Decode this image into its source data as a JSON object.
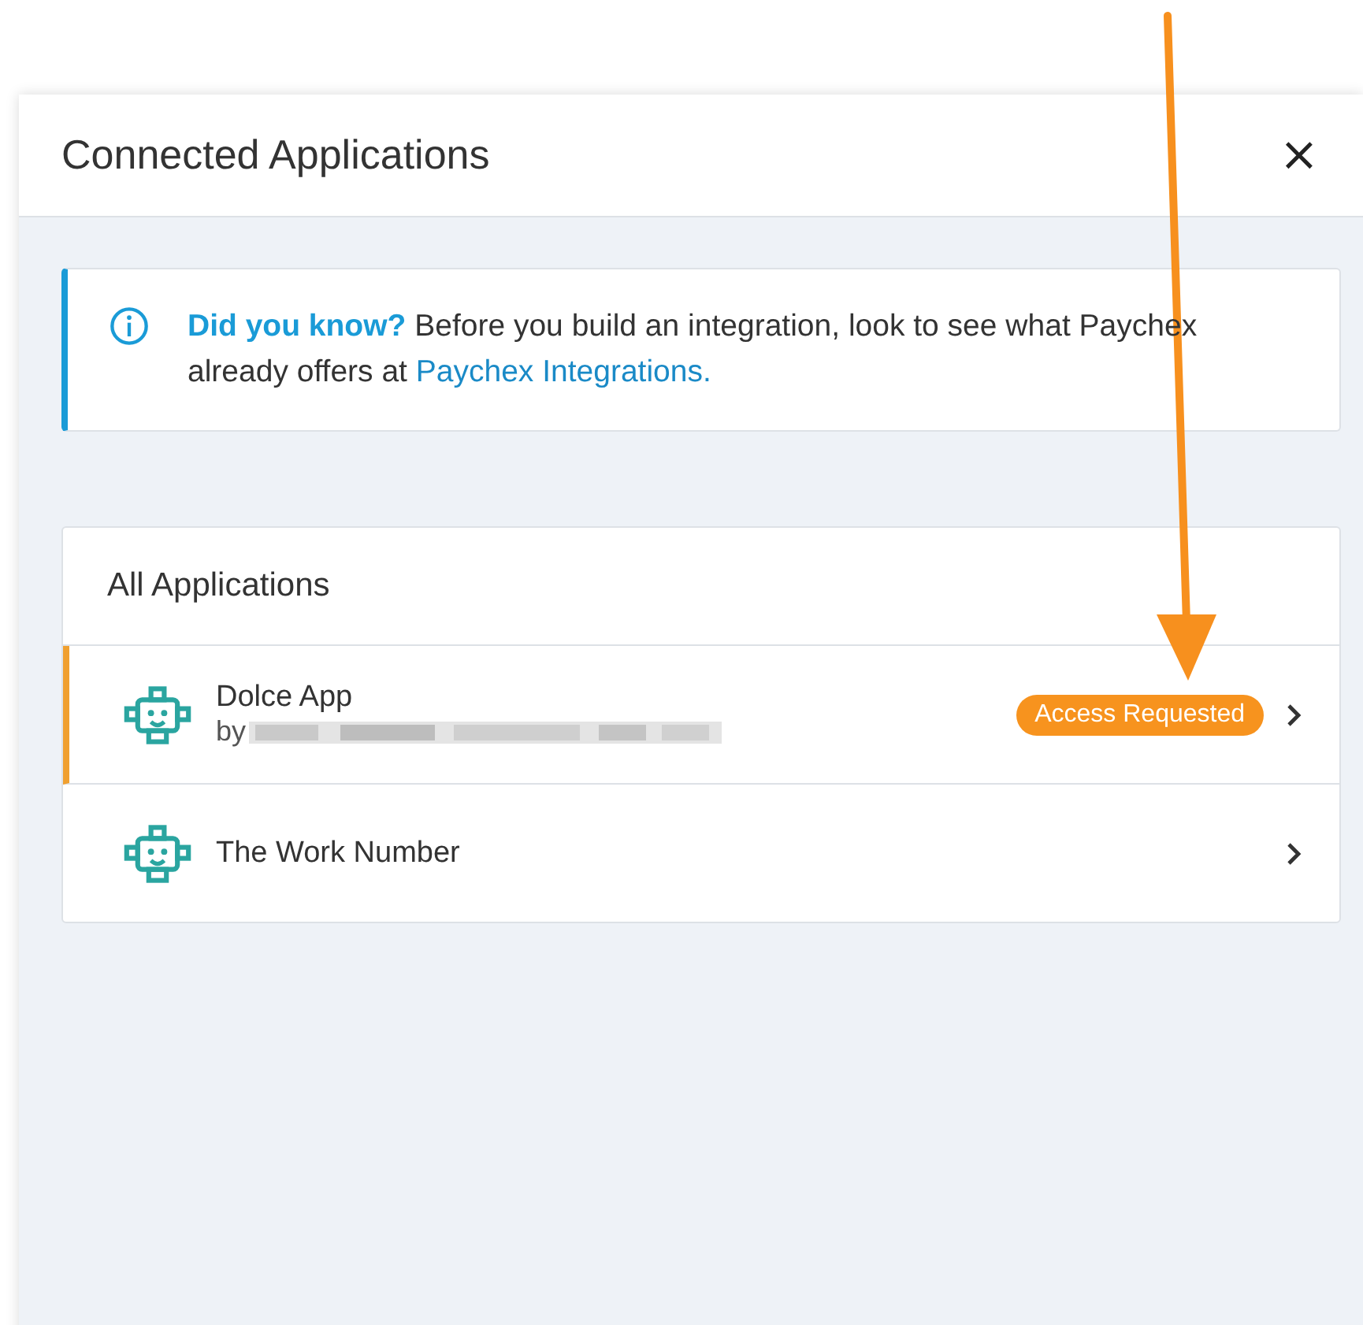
{
  "dialog": {
    "title": "Connected Applications",
    "close_label": "×"
  },
  "notice": {
    "text": "**Did you know?** Before you build an integration, look to see what Paychex already offers at",
    "link": "Paychex Integrations."
  },
  "applications": {
    "heading": "All Applications",
    "items": [
      {
        "name": "Dolce App",
        "vendor": "by",
        "vendor_redacted": true,
        "badge": "Access Requested",
        "highlighted": true
      },
      {
        "name": "The Work Number",
        "vendor_redacted": false,
        "highlighted": false
      }
    ]
  }
}
